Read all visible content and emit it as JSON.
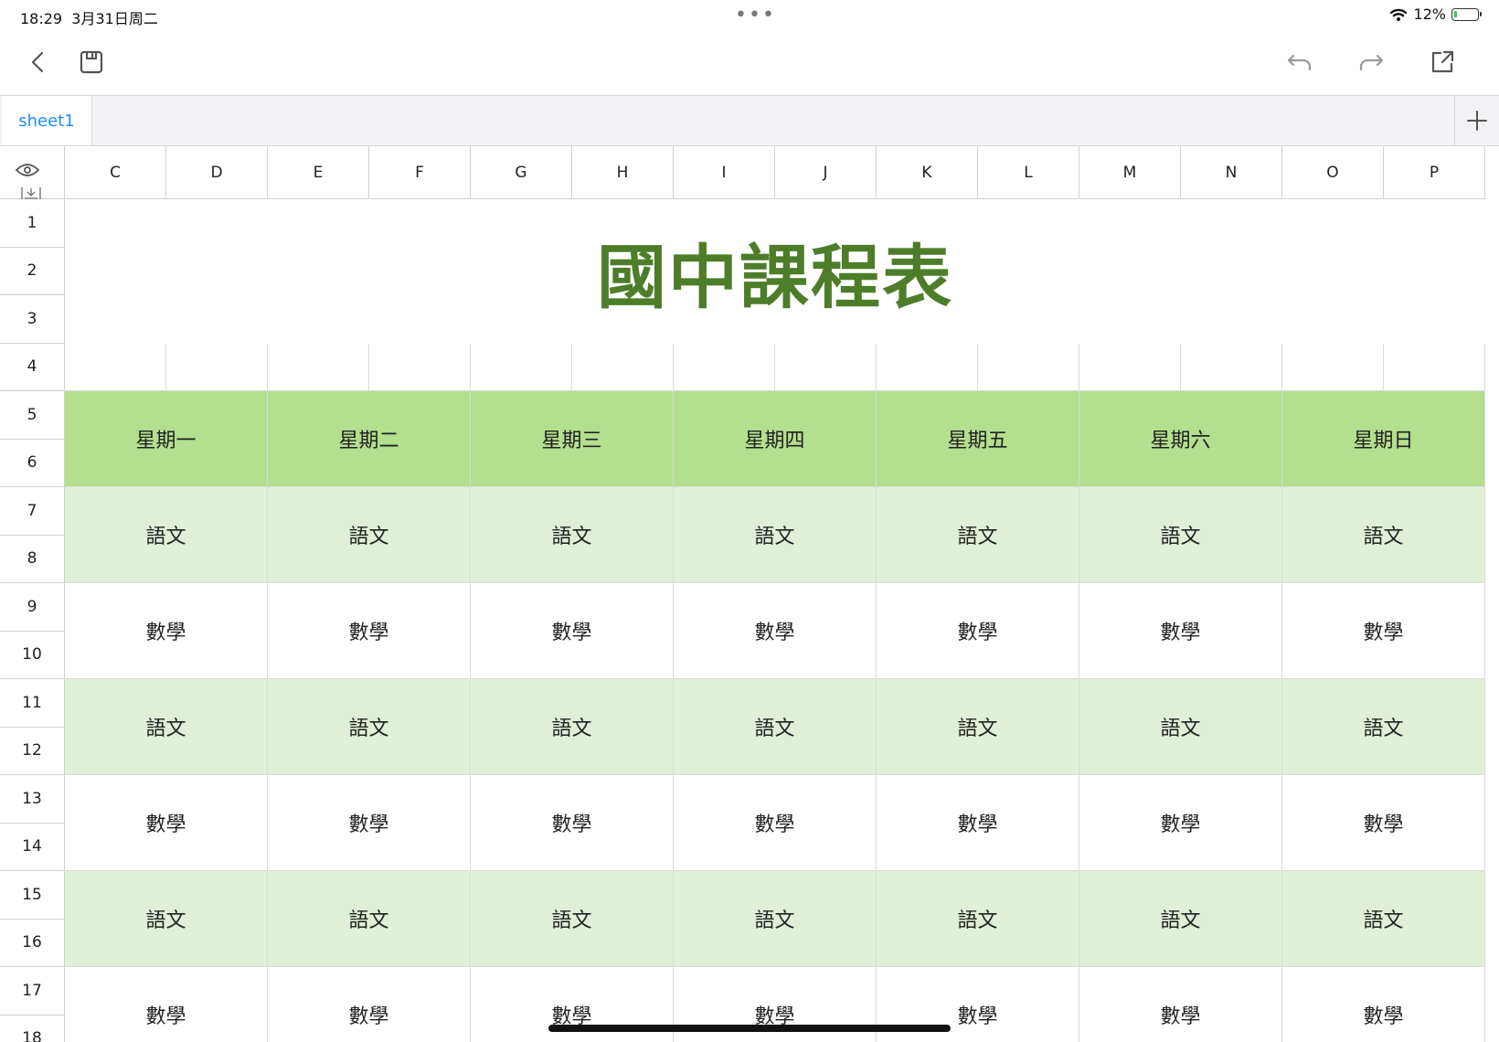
{
  "status": {
    "time": "18:29",
    "date": "3月31日周二",
    "battery": "12%",
    "battery_level": 0.12
  },
  "toolbar": {
    "back_icon": "chevron-left-icon",
    "save_icon": "save-icon",
    "undo_icon": "undo-icon",
    "redo_icon": "redo-icon",
    "share_icon": "share-icon"
  },
  "tabs": [
    {
      "label": "sheet1",
      "active": true
    }
  ],
  "columns": [
    "C",
    "D",
    "E",
    "F",
    "G",
    "H",
    "I",
    "J",
    "K",
    "L",
    "M",
    "N",
    "O",
    "P"
  ],
  "rows": [
    "1",
    "2",
    "3",
    "4",
    "5",
    "6",
    "7",
    "8",
    "9",
    "10",
    "11",
    "12",
    "13",
    "14",
    "15",
    "16",
    "17",
    "18"
  ],
  "sheet": {
    "title": "國中課程表",
    "days": [
      "星期一",
      "星期二",
      "星期三",
      "星期四",
      "星期五",
      "星期六",
      "星期日"
    ],
    "periods": [
      [
        "語文",
        "語文",
        "語文",
        "語文",
        "語文",
        "語文",
        "語文"
      ],
      [
        "數學",
        "數學",
        "數學",
        "數學",
        "數學",
        "數學",
        "數學"
      ],
      [
        "語文",
        "語文",
        "語文",
        "語文",
        "語文",
        "語文",
        "語文"
      ],
      [
        "數學",
        "數學",
        "數學",
        "數學",
        "數學",
        "數學",
        "數學"
      ],
      [
        "語文",
        "語文",
        "語文",
        "語文",
        "語文",
        "語文",
        "語文"
      ],
      [
        "數學",
        "數學",
        "數學",
        "數學",
        "數學",
        "數學",
        "數學"
      ]
    ]
  },
  "colors": {
    "title": "#4e7d2a",
    "header_fill": "#b3df8e",
    "band_fill": "#e1efd7",
    "tab_text": "#1a8cff"
  }
}
